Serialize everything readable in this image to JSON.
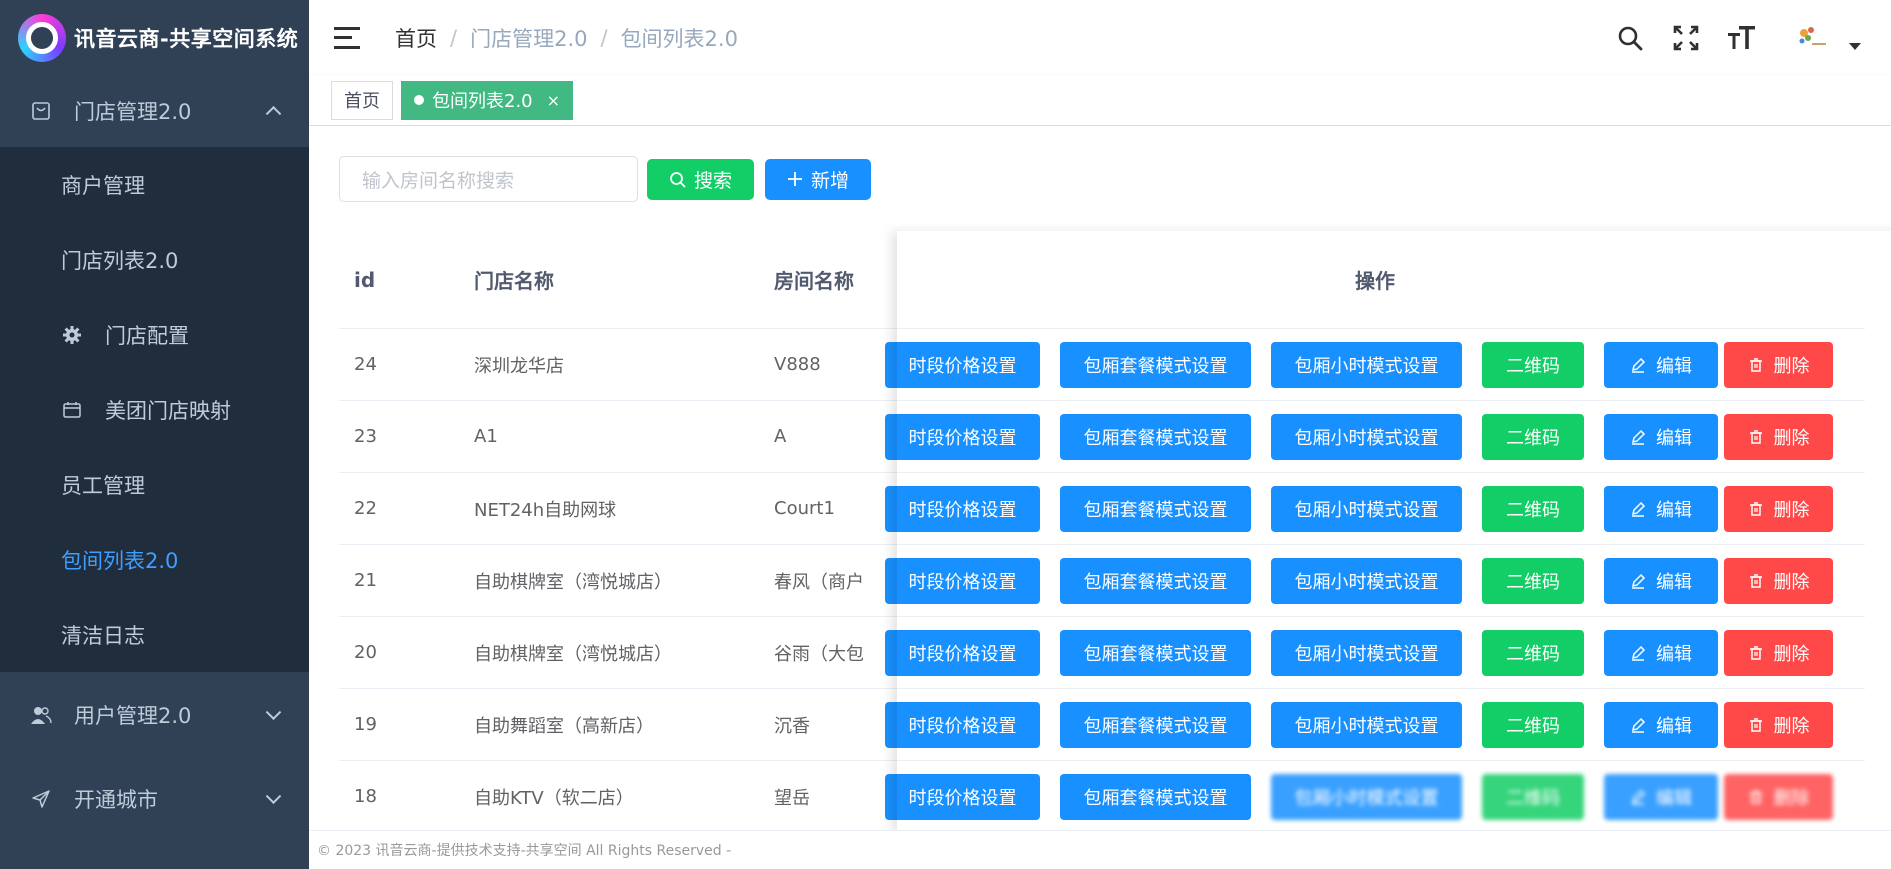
{
  "app": {
    "title": "讯音云商-共享空间系统"
  },
  "sidebar": {
    "groups": [
      {
        "label": "门店管理2.0",
        "expanded": true
      },
      {
        "label": "用户管理2.0",
        "expanded": false
      },
      {
        "label": "开通城市",
        "expanded": false
      }
    ],
    "items": [
      {
        "label": "商户管理"
      },
      {
        "label": "门店列表2.0"
      },
      {
        "label": "门店配置"
      },
      {
        "label": "美团门店映射"
      },
      {
        "label": "员工管理"
      },
      {
        "label": "包间列表2.0",
        "active": true
      },
      {
        "label": "清洁日志"
      }
    ]
  },
  "header": {
    "breadcrumb": [
      "首页",
      "门店管理2.0",
      "包间列表2.0"
    ],
    "breadcrumb_sep": "/"
  },
  "tags": [
    {
      "label": "首页",
      "active": false
    },
    {
      "label": "包间列表2.0",
      "active": true,
      "close": "×"
    }
  ],
  "search": {
    "placeholder": "输入房间名称搜索",
    "search_label": "搜索",
    "add_label": "新增"
  },
  "table": {
    "columns": [
      "id",
      "门店名称",
      "房间名称",
      "操作"
    ],
    "rows": [
      {
        "id": "24",
        "store": "深圳龙华店",
        "room": "V888"
      },
      {
        "id": "23",
        "store": "A1",
        "room": "A"
      },
      {
        "id": "22",
        "store": "NET24h自助网球",
        "room": "Court1"
      },
      {
        "id": "21",
        "store": "自助棋牌室（湾悦城店）",
        "room": "春风（商户无"
      },
      {
        "id": "20",
        "store": "自助棋牌室（湾悦城店）",
        "room": "谷雨（大包..."
      },
      {
        "id": "19",
        "store": "自助舞蹈室（高新店）",
        "room": "沉香"
      },
      {
        "id": "18",
        "store": "自助KTV（软二店）",
        "room": "望岳"
      }
    ],
    "actions": {
      "time_price": "时段价格设置",
      "package_mode": "包厢套餐模式设置",
      "hour_mode": "包厢小时模式设置",
      "qrcode": "二维码",
      "edit": "编辑",
      "delete": "删除"
    }
  },
  "footer": {
    "text": "© 2023 讯音云商-提供技术支持-共享空间 All Rights Reserved -"
  },
  "colors": {
    "sidebar_bg": "#304156",
    "submenu_bg": "#1f2d3d",
    "active_menu": "#409eff",
    "primary": "#1890ff",
    "success": "#13ce66",
    "danger": "#ff4949",
    "tag_active": "#42b983"
  },
  "icons": {
    "menu_store": "store-icon",
    "menu_user": "user-icon",
    "menu_city": "send-icon",
    "config": "gear-icon",
    "meituan": "calendar-icon",
    "search": "search-icon",
    "fullscreen": "fullscreen-icon",
    "fontsize": "font-size-icon",
    "edit": "edit-icon",
    "delete": "trash-icon",
    "add": "plus-icon"
  }
}
